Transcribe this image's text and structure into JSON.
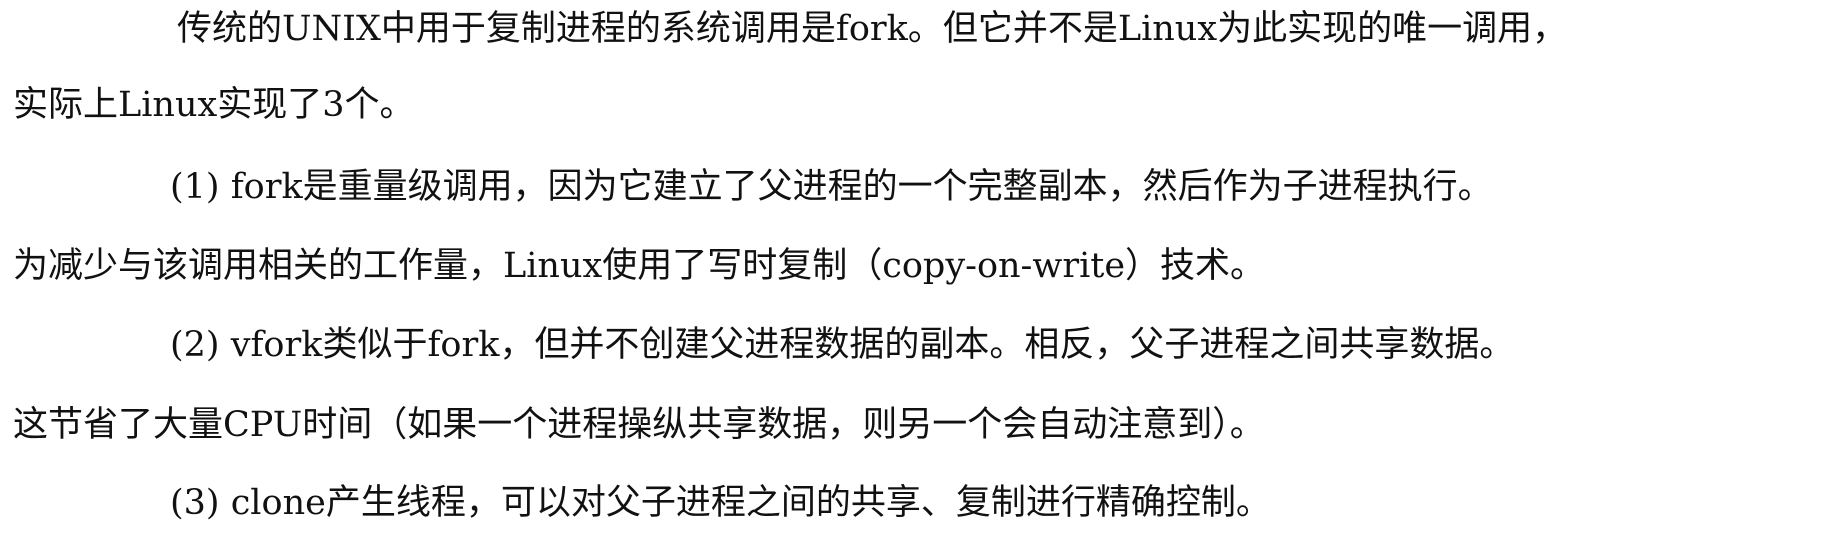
{
  "paragraphs": [
    {
      "lines": [
        "传统的UNIX中用于复制进程的系统调用是fork。但它并不是Linux为此实现的唯一调用，",
        "实际上Linux实现了3个。"
      ]
    },
    {
      "lines": [
        "(1) fork是重量级调用，因为它建立了父进程的一个完整副本，然后作为子进程执行。",
        "为减少与该调用相关的工作量，Linux使用了写时复制（copy-on-write）技术。"
      ]
    },
    {
      "lines": [
        "(2) vfork类似于fork，但并不创建父进程数据的副本。相反，父子进程之间共享数据。",
        "这节省了大量CPU时间（如果一个进程操纵共享数据，则另一个会自动注意到）。"
      ]
    },
    {
      "lines": [
        "(3) clone产生线程，可以对父子进程之间的共享、复制进行精确控制。"
      ]
    }
  ]
}
